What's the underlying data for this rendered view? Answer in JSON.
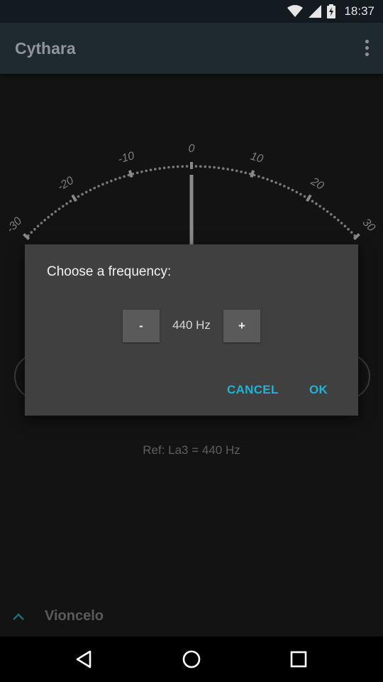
{
  "status_bar": {
    "time": "18:37",
    "icons": [
      "wifi-icon",
      "cell-signal-icon",
      "battery-charging-icon"
    ]
  },
  "app_bar": {
    "title": "Cythara",
    "menu_icon": "overflow-menu-icon"
  },
  "gauge": {
    "tick_labels": [
      "-30",
      "-20",
      "-10",
      "0",
      "10",
      "20",
      "30"
    ],
    "needle_value": 0
  },
  "dialog": {
    "title": "Choose a frequency:",
    "minus_label": "-",
    "plus_label": "+",
    "value": "440 Hz",
    "cancel_label": "CANCEL",
    "ok_label": "OK"
  },
  "reference": {
    "text": "Ref: La3 = 440 Hz"
  },
  "instrument": {
    "name": "Vioncelo",
    "expand_icon": "chevron-up-icon"
  },
  "nav_bar": {
    "icons": [
      "back-icon",
      "home-icon",
      "recents-icon"
    ]
  },
  "colors": {
    "accent": "#1fb3d4",
    "app_bar": "#1f2a30",
    "background": "#131313",
    "dialog": "#404040"
  }
}
